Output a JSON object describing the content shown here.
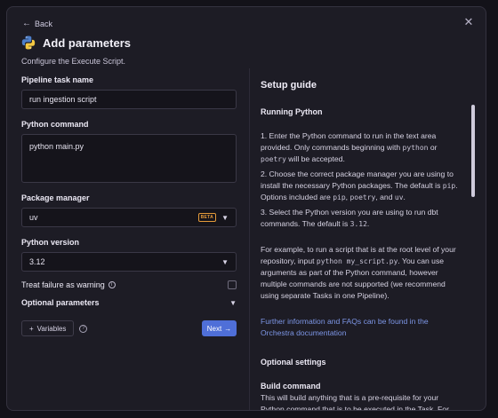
{
  "header": {
    "back_label": "Back",
    "close_icon": "close-icon",
    "title": "Add parameters",
    "subtitle": "Configure the Execute Script.",
    "logo_icon": "python-logo-icon"
  },
  "form": {
    "task_name": {
      "label": "Pipeline task name",
      "value": "run ingestion script"
    },
    "python_command": {
      "label": "Python command",
      "value": "python main.py"
    },
    "package_manager": {
      "label": "Package manager",
      "value": "uv",
      "badge": "BETA"
    },
    "python_version": {
      "label": "Python version",
      "value": "3.12"
    },
    "treat_failure": {
      "label": "Treat failure as warning",
      "checked": false
    },
    "optional_params": {
      "label": "Optional parameters"
    }
  },
  "footer": {
    "variables_label": "Variables",
    "next_label": "Next"
  },
  "guide": {
    "title": "Setup guide",
    "section_title": "Running Python",
    "p1_a": "1. Enter the Python command to run in the text area provided. Only commands beginning with ",
    "p1_code1": "python",
    "p1_b": " or ",
    "p1_code2": "poetry",
    "p1_c": " will be accepted.",
    "p2_a": "2. Choose the correct package manager you are using to install the necessary Python packages. The default is ",
    "p2_code1": "pip",
    "p2_b": ". Options included are ",
    "p2_code2": "pip",
    "p2_c": ", ",
    "p2_code3": "poetry",
    "p2_d": ", and ",
    "p2_code4": "uv",
    "p2_e": ".",
    "p3_a": "3. Select the Python version you are using to run dbt commands. The default is ",
    "p3_code": "3.12",
    "p3_b": ".",
    "p4_a": "For example, to run a script that is at the root level of your repository, input ",
    "p4_code": "python my_script.py",
    "p4_b": ". You can use arguments as part of the Python command, however multiple commands are not supported (we recommend using separate Tasks in one Pipeline).",
    "link_text": "Further information and FAQs can be found in the Orchestra documentation",
    "optional_title": "Optional settings",
    "build_title": "Build command",
    "build_text": "This will build anything that is a pre-requisite for your Python command that is to be executed in the Task. For"
  },
  "colors": {
    "accent": "#4f6fd8",
    "beta": "#e49a3a",
    "link": "#7d96e6"
  }
}
